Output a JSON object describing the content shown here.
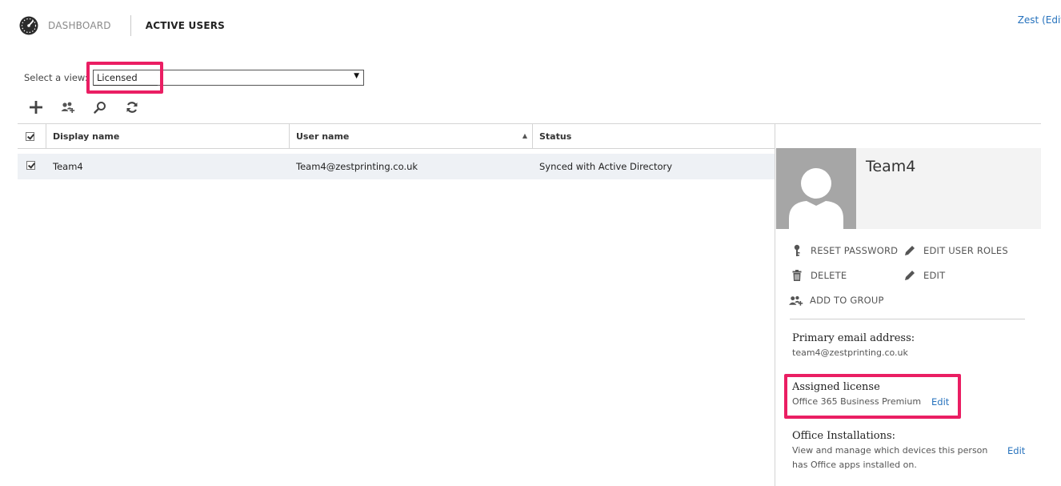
{
  "header": {
    "nav_dashboard": "DASHBOARD",
    "nav_active": "ACTIVE USERS",
    "user_link": "Zest (Edit"
  },
  "view": {
    "label": "Select a view:",
    "selected": "Licensed"
  },
  "toolbar": {
    "icons": [
      "add-icon",
      "bulk-add-users-icon",
      "search-icon",
      "refresh-icon"
    ]
  },
  "table": {
    "columns": {
      "display_name": "Display name",
      "user_name": "User name",
      "status": "Status"
    },
    "rows": [
      {
        "display_name": "Team4",
        "user_name": "Team4@zestprinting.co.uk",
        "status": "Synced with Active Directory",
        "checked": true
      }
    ]
  },
  "pane": {
    "name": "Team4",
    "actions": {
      "reset_password": "RESET PASSWORD",
      "edit_user_roles": "EDIT USER ROLES",
      "delete": "DELETE",
      "edit": "EDIT",
      "add_to_group": "ADD TO GROUP"
    },
    "primary_email_title": "Primary email address:",
    "primary_email": "team4@zestprinting.co.uk",
    "license_title": "Assigned license",
    "license_value": "Office 365 Business Premium",
    "license_edit": "Edit",
    "installs_title": "Office Installations:",
    "installs_line1": "View and manage which devices this person",
    "installs_line2": "has Office apps installed on.",
    "installs_edit": "Edit"
  },
  "colors": {
    "accent_link": "#2672bd",
    "highlight": "#ea1e63",
    "row_selected": "#eef1f5"
  }
}
